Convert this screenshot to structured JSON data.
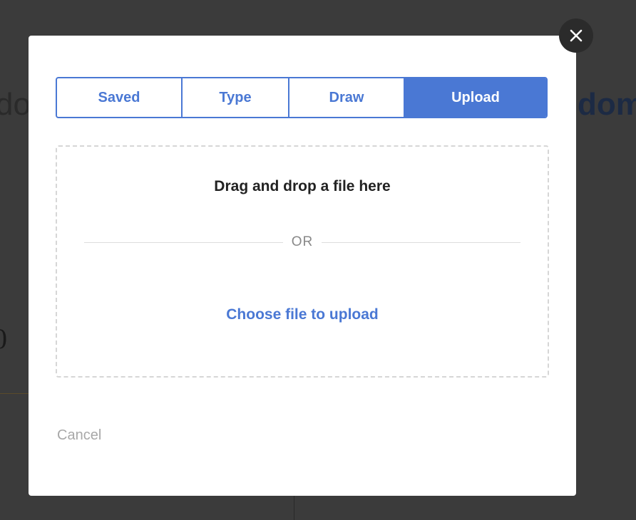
{
  "background": {
    "left_fragment": "do",
    "right_fragment": "dom",
    "left_number": "0"
  },
  "modal": {
    "close_icon": "close-icon",
    "tabs": [
      {
        "label": "Saved",
        "active": false
      },
      {
        "label": "Type",
        "active": false
      },
      {
        "label": "Draw",
        "active": false
      },
      {
        "label": "Upload",
        "active": true
      }
    ],
    "dropzone": {
      "title": "Drag and drop a file here",
      "divider_text": "OR",
      "choose_link": "Choose file to upload"
    },
    "cancel_label": "Cancel"
  },
  "colors": {
    "accent": "#4a78d4",
    "overlay": "#3b3b3b",
    "close_button": "#2b2b2b"
  }
}
